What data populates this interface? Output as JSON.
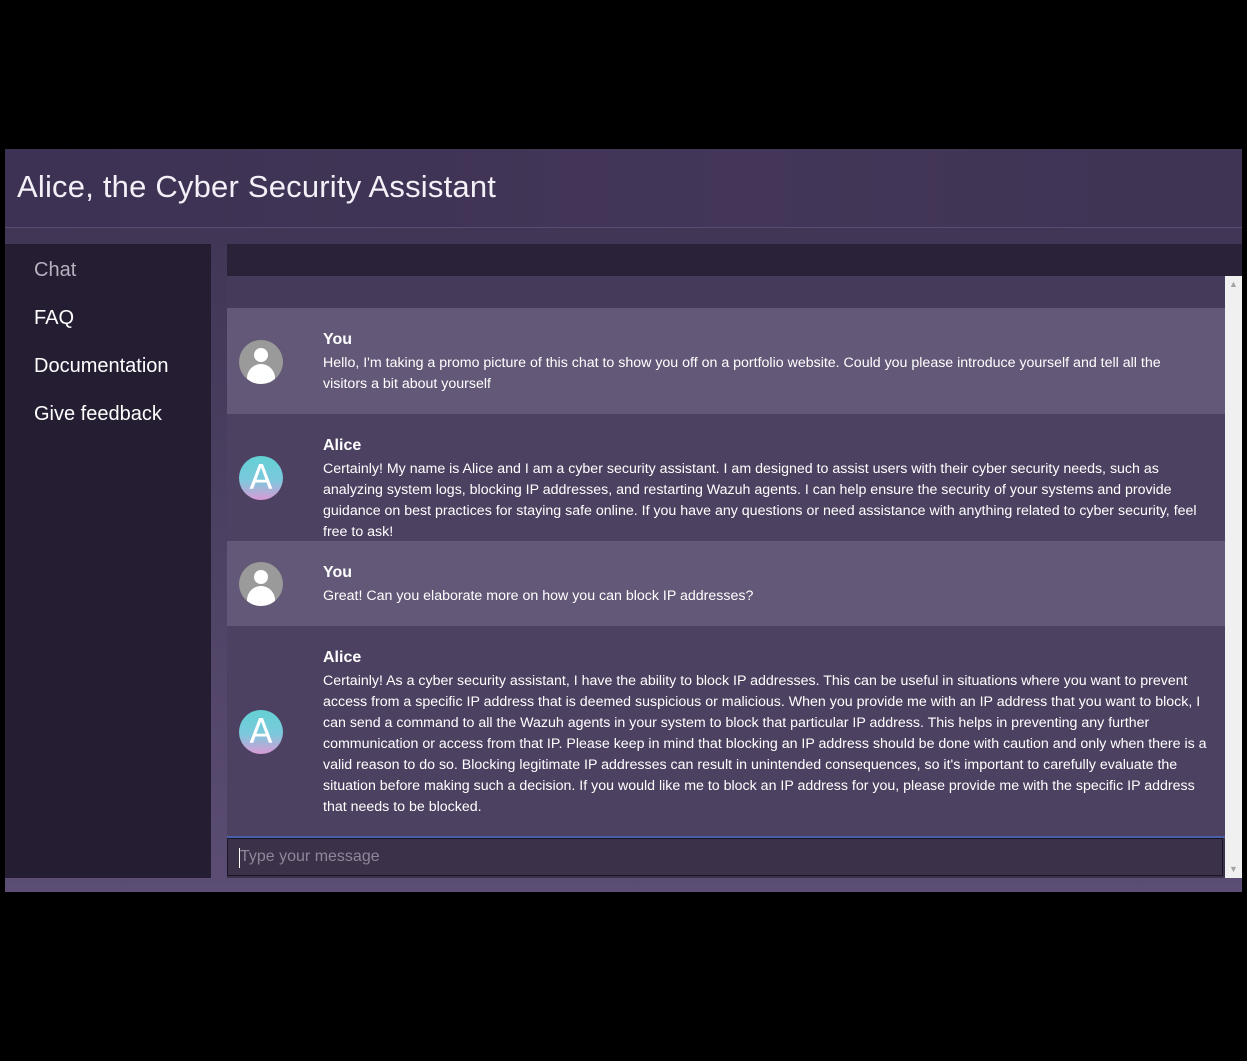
{
  "header": {
    "title": "Alice, the Cyber Security Assistant"
  },
  "sidebar": {
    "items": [
      {
        "label": "Chat",
        "active": true
      },
      {
        "label": "FAQ",
        "active": false
      },
      {
        "label": "Documentation",
        "active": false
      },
      {
        "label": "Give feedback",
        "active": false
      }
    ]
  },
  "chat": {
    "messages": [
      {
        "sender": "You",
        "role": "user",
        "avatar": "user-icon",
        "text": "Hello, I'm taking a promo picture of this chat to show you off on a portfolio website. Could you please introduce yourself and tell all the visitors a bit about yourself"
      },
      {
        "sender": "Alice",
        "role": "assistant",
        "avatar": "A",
        "text": "Certainly! My name is Alice and I am a cyber security assistant. I am designed to assist users with their cyber security needs, such as analyzing system logs, blocking IP addresses, and restarting Wazuh agents. I can help ensure the security of your systems and provide guidance on best practices for staying safe online. If you have any questions or need assistance with anything related to cyber security, feel free to ask!"
      },
      {
        "sender": "You",
        "role": "user",
        "avatar": "user-icon",
        "text": "Great! Can you elaborate more on how you can block IP addresses?"
      },
      {
        "sender": "Alice",
        "role": "assistant",
        "avatar": "A",
        "text": "Certainly! As a cyber security assistant, I have the ability to block IP addresses. This can be useful in situations where you want to prevent access from a specific IP address that is deemed suspicious or malicious. When you provide me with an IP address that you want to block, I can send a command to all the Wazuh agents in your system to block that particular IP address. This helps in preventing any further communication or access from that IP. Please keep in mind that blocking an IP address should be done with caution and only when there is a valid reason to do so. Blocking legitimate IP addresses can result in unintended consequences, so it's important to carefully evaluate the situation before making such a decision. If you would like me to block an IP address for you, please provide me with the specific IP address that needs to be blocked."
      }
    ],
    "input": {
      "value": "",
      "placeholder": "Type your message"
    }
  },
  "scrollbar": {
    "up_icon": "▲",
    "down_icon": "▼"
  },
  "colors": {
    "background": "#000000",
    "header": "#3d3253",
    "sidebar": "#251e33",
    "user_message": "#635877",
    "assistant_message": "#4c4160",
    "input_focus_border": "#4a5fa8"
  }
}
